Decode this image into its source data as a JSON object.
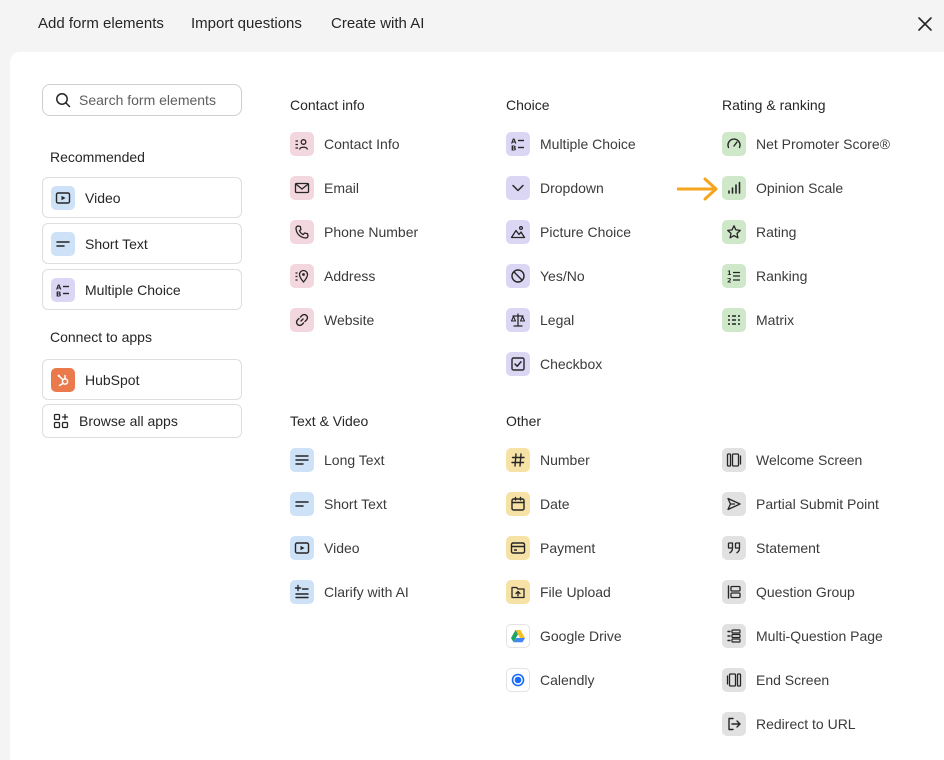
{
  "tabs": [
    "Add form elements",
    "Import questions",
    "Create with AI"
  ],
  "search": {
    "placeholder": "Search form elements"
  },
  "sidebar": {
    "recommended_heading": "Recommended",
    "recommended": [
      "Video",
      "Short Text",
      "Multiple Choice"
    ],
    "apps_heading": "Connect to apps",
    "apps": [
      "HubSpot"
    ],
    "browse_label": "Browse all apps"
  },
  "columns": {
    "contact": {
      "heading": "Contact info",
      "items": [
        "Contact Info",
        "Email",
        "Phone Number",
        "Address",
        "Website"
      ]
    },
    "choice": {
      "heading": "Choice",
      "items": [
        "Multiple Choice",
        "Dropdown",
        "Picture Choice",
        "Yes/No",
        "Legal",
        "Checkbox"
      ]
    },
    "rating": {
      "heading": "Rating & ranking",
      "items": [
        "Net Promoter Score®",
        "Opinion Scale",
        "Rating",
        "Ranking",
        "Matrix"
      ]
    },
    "text": {
      "heading": "Text & Video",
      "items": [
        "Long Text",
        "Short Text",
        "Video",
        "Clarify with AI"
      ]
    },
    "other": {
      "heading": "Other",
      "items": [
        "Number",
        "Date",
        "Payment",
        "File Upload",
        "Google Drive",
        "Calendly"
      ]
    },
    "screens": {
      "items": [
        "Welcome Screen",
        "Partial Submit Point",
        "Statement",
        "Question Group",
        "Multi-Question Page",
        "End Screen",
        "Redirect to URL"
      ]
    }
  },
  "colors": {
    "pink": "#f3d7de",
    "purple": "#dcd6f5",
    "green": "#cfe8c9",
    "blue": "#cde1f7",
    "yellow": "#f7e2a6",
    "gray": "#e1e1e1",
    "arrow": "#f5a41e",
    "hubspot": "#ea7a4b"
  }
}
